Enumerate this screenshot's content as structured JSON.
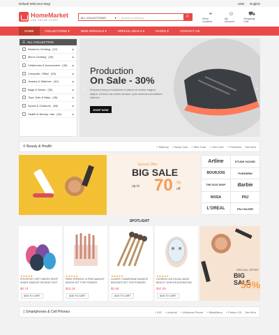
{
  "topbar": {
    "welcome": "Default Welcome Msg!",
    "currency": "USD",
    "language": "English"
  },
  "header": {
    "logo": "HomeMarket",
    "tagline": "ONE ONLINE STORE",
    "search_category": "ALL COLLECTIONS",
    "search_placeholder": "Search something",
    "store_location": "Store Location",
    "my_account": "My Account",
    "shopping_cart": "Shopping Cart",
    "cart_count": "0"
  },
  "nav": {
    "items": [
      "HOME",
      "COLLECTIONS",
      "NEW ARRIVALS",
      "SPECIAL DEALS",
      "PAGES",
      "CONTACT US"
    ]
  },
  "categories": {
    "header": "ALL COLLECTION",
    "items": [
      {
        "label": "Women's Clothing",
        "count": "(27)"
      },
      {
        "label": "Men's Clothing",
        "count": "(29)"
      },
      {
        "label": "Cellphones & Accessories",
        "count": "(45)"
      },
      {
        "label": "Computer, Office",
        "count": "(25)"
      },
      {
        "label": "Jewelry & Watches",
        "count": "(42)"
      },
      {
        "label": "Bags & Shoes",
        "count": "(32)"
      },
      {
        "label": "Toys, Kids & Baby",
        "count": "(45)"
      },
      {
        "label": "Sports & Outdoors",
        "count": "(38)"
      },
      {
        "label": "Health & Beauty, Hair",
        "count": "(32)"
      }
    ]
  },
  "hero": {
    "title": "Production",
    "sale": "On Sale - 30%",
    "desc": "Eiusmod tempor incididunt ut labore et dolore magna aliqua. Ut enim ad minim veniam, quis nostrud exercitation ullamco",
    "button": "SHOP NOW"
  },
  "beauty": {
    "title": "Beauty & Health",
    "tags": [
      "+ Makeup",
      "+ Body Care",
      "+ Skin Care",
      "+ Hair Care",
      "+ Perfumes"
    ],
    "see_all": "See All"
  },
  "banner": {
    "special": "Special Offer",
    "big_sale": "BIG SALE",
    "up_to": "up to",
    "percent": "70",
    "percent_sign": "%",
    "off": "off"
  },
  "brands": [
    "Artline",
    "ETUDE HOUSE",
    "BOURJOIS",
    "PURDERM",
    "THE FACE SHOP",
    "Barbie",
    "NIVEA",
    "PNJ",
    "L'OREAL",
    "PNJ SILVER"
  ],
  "spotlight": {
    "title": "SPOTLIGHT",
    "products": [
      {
        "name": "POCKPOST SOFT WATER DROP SHAPE MAKEUP SPONGE PUFF",
        "price": "$0.74",
        "add": "ADD TO CART"
      },
      {
        "name": "PARK SPRINGS 10 PINK MAKEUP BRUSH SET FOR POWDER",
        "price": "$10.18",
        "add": "ADD TO CART"
      },
      {
        "name": "LUXURY CHAMPAGNE MAKEUP BRUSHES SET FOR POWDER",
        "price": "$1.98",
        "add": "ADD TO CART"
      },
      {
        "name": "LICHENG LED FACIAL MASK BEAUTY SKIN REJUVENATION",
        "price": "$47.29",
        "add": "ADD TO CART"
      }
    ],
    "stars": "★★★★★"
  },
  "sidebanner": {
    "special": "SPECIAL OFFER",
    "big_sale": "BIG SALE",
    "up": "50%"
  },
  "phones": {
    "title": "Smartphones & Cell Phones",
    "tags": [
      "+ iOS",
      "+ Android",
      "+ Windows Phone",
      "+ BlackBerry",
      "+ Firefox OS"
    ],
    "see_all": "See All"
  }
}
